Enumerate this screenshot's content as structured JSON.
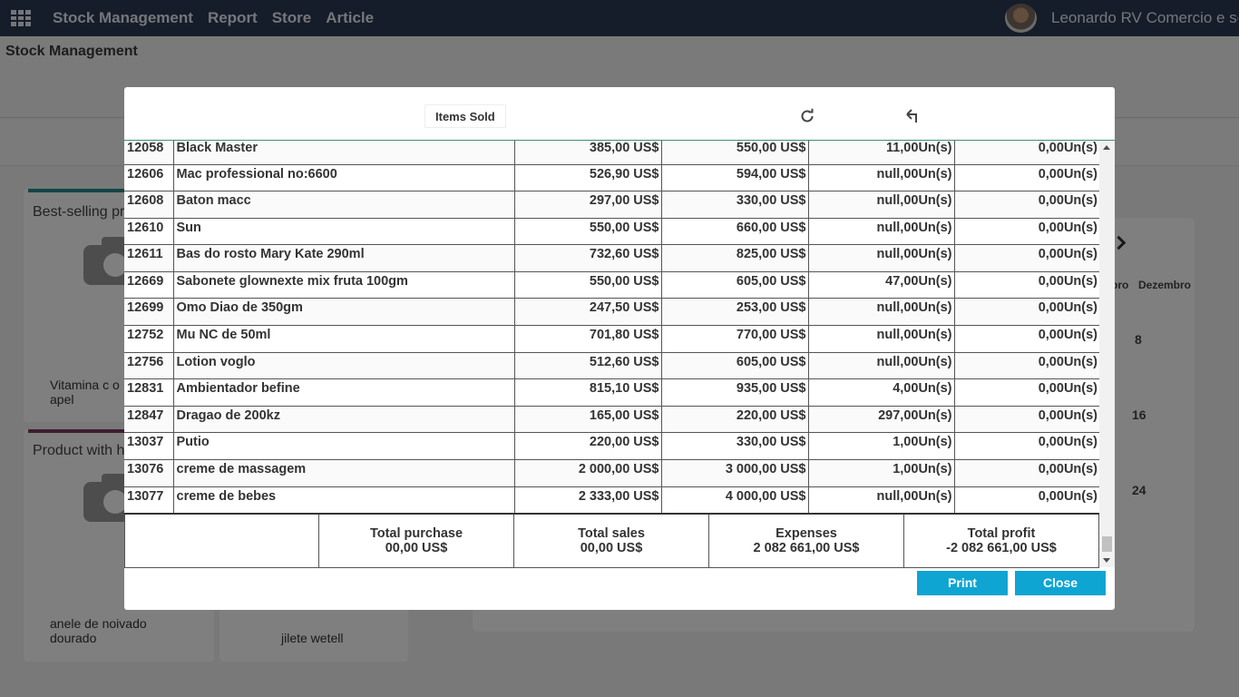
{
  "navbar": {
    "menu": [
      "Stock Management",
      "Report",
      "Store",
      "Article"
    ],
    "user_name": "Leonardo RV Comercio e se"
  },
  "breadcrumb": {
    "title": "Stock Management"
  },
  "background": {
    "card1_title": "Best-selling pr",
    "card1_caption": "Vitamina c o \napel",
    "card2_title": "Product with h",
    "card2_caption": "anele de noivado\ndourado",
    "card3_caption": "jilete wetell",
    "calendar": {
      "month_a": "bro",
      "month_b": "Dezembro",
      "days": [
        "8",
        "16",
        "24"
      ]
    },
    "colors": {
      "card1_bar": "#2a8b8b",
      "card2_bar": "#7a3c62"
    }
  },
  "modal": {
    "tab_label": "Items Sold",
    "icons": [
      "refresh-icon",
      "back-icon"
    ],
    "rows": [
      {
        "code": "12058",
        "name": "Black Master",
        "cost": "385,00 US$",
        "price": "550,00 US$",
        "stock": "11,00Un(s)",
        "sold": "0,00Un(s)"
      },
      {
        "code": "12606",
        "name": "Mac professional no:6600",
        "cost": "526,90 US$",
        "price": "594,00 US$",
        "stock": "null,00Un(s)",
        "sold": "0,00Un(s)"
      },
      {
        "code": "12608",
        "name": "Baton macc",
        "cost": "297,00 US$",
        "price": "330,00 US$",
        "stock": "null,00Un(s)",
        "sold": "0,00Un(s)"
      },
      {
        "code": "12610",
        "name": "Sun",
        "cost": "550,00 US$",
        "price": "660,00 US$",
        "stock": "null,00Un(s)",
        "sold": "0,00Un(s)"
      },
      {
        "code": "12611",
        "name": "Bas do rosto Mary Kate 290ml",
        "cost": "732,60 US$",
        "price": "825,00 US$",
        "stock": "null,00Un(s)",
        "sold": "0,00Un(s)"
      },
      {
        "code": "12669",
        "name": "Sabonete glownexte mix fruta 100gm",
        "cost": "550,00 US$",
        "price": "605,00 US$",
        "stock": "47,00Un(s)",
        "sold": "0,00Un(s)"
      },
      {
        "code": "12699",
        "name": "Omo Diao de 350gm",
        "cost": "247,50 US$",
        "price": "253,00 US$",
        "stock": "null,00Un(s)",
        "sold": "0,00Un(s)"
      },
      {
        "code": "12752",
        "name": "Mu NC de 50ml",
        "cost": "701,80 US$",
        "price": "770,00 US$",
        "stock": "null,00Un(s)",
        "sold": "0,00Un(s)"
      },
      {
        "code": "12756",
        "name": "Lotion voglo",
        "cost": "512,60 US$",
        "price": "605,00 US$",
        "stock": "null,00Un(s)",
        "sold": "0,00Un(s)"
      },
      {
        "code": "12831",
        "name": "Ambientador befine",
        "cost": "815,10 US$",
        "price": "935,00 US$",
        "stock": "4,00Un(s)",
        "sold": "0,00Un(s)"
      },
      {
        "code": "12847",
        "name": "Dragao de 200kz",
        "cost": "165,00 US$",
        "price": "220,00 US$",
        "stock": "297,00Un(s)",
        "sold": "0,00Un(s)"
      },
      {
        "code": "13037",
        "name": "Putio",
        "cost": "220,00 US$",
        "price": "330,00 US$",
        "stock": "1,00Un(s)",
        "sold": "0,00Un(s)"
      },
      {
        "code": "13076",
        "name": "creme de massagem",
        "cost": "2 000,00 US$",
        "price": "3 000,00 US$",
        "stock": "1,00Un(s)",
        "sold": "0,00Un(s)"
      },
      {
        "code": "13077",
        "name": "creme de bebes",
        "cost": "2 333,00 US$",
        "price": "4 000,00 US$",
        "stock": "null,00Un(s)",
        "sold": "0,00Un(s)"
      }
    ],
    "totals": {
      "purchase_label": "Total purchase",
      "purchase_value": "00,00 US$",
      "sales_label": "Total sales",
      "sales_value": "00,00 US$",
      "expenses_label": "Expenses",
      "expenses_value": "2 082 661,00 US$",
      "profit_label": "Total profit",
      "profit_value": "-2 082 661,00 US$"
    },
    "print_label": "Print",
    "close_label": "Close"
  }
}
